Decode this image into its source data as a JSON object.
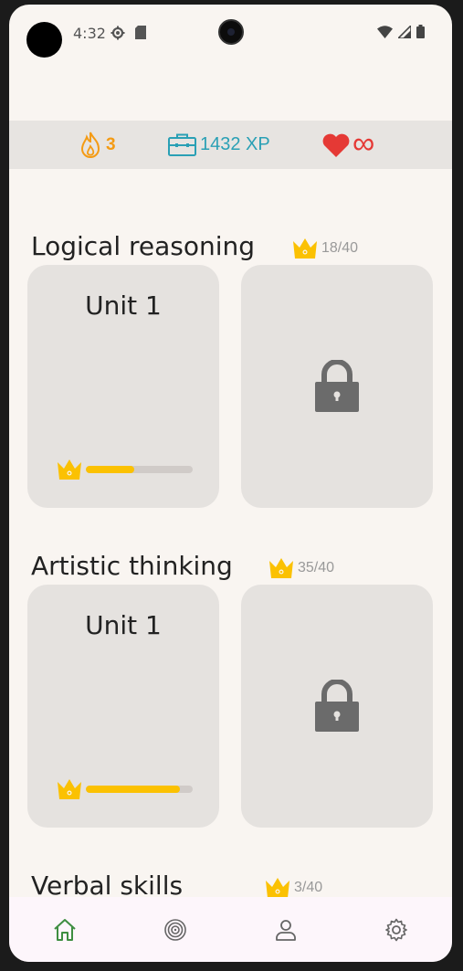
{
  "status_bar": {
    "time": "4:32",
    "icons": [
      "settings-icon",
      "sd-card-icon",
      "wifi-icon",
      "signal-icon",
      "battery-icon"
    ]
  },
  "stats": {
    "streak": "3",
    "xp": "1432 XP",
    "hearts": "∞",
    "colors": {
      "streak": "#f49b14",
      "xp": "#2aa0b5",
      "hearts": "#e53935"
    }
  },
  "sections": [
    {
      "title": "Logical reasoning",
      "crowns": "18/40",
      "unit_title": "Unit 1",
      "progress": 0.45,
      "locked_card": "lock-icon"
    },
    {
      "title": "Artistic thinking",
      "crowns": "35/40",
      "unit_title": "Unit 1",
      "progress": 0.88,
      "locked_card": "lock-icon"
    },
    {
      "title": "Verbal skills",
      "crowns": "3/40"
    }
  ],
  "bottom_nav": {
    "items": [
      "home-icon",
      "target-icon",
      "profile-icon",
      "settings-icon"
    ],
    "active": "home-icon"
  },
  "colors": {
    "crown": "#fbc102",
    "background": "#f9f5f1",
    "card": "#e5e2df",
    "lock": "#6b6b6b"
  }
}
